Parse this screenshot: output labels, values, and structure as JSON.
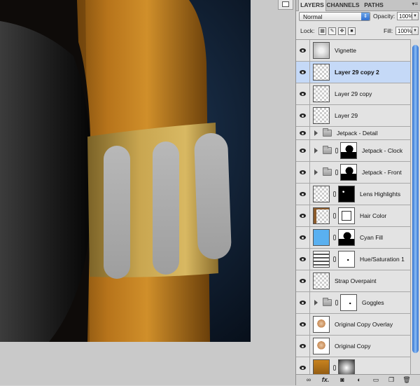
{
  "panel": {
    "tabs": [
      {
        "label": "LAYERS",
        "active": true
      },
      {
        "label": "CHANNELS",
        "active": false
      },
      {
        "label": "PATHS",
        "active": false
      }
    ],
    "menu_glyph": "▾≡",
    "blend_mode": "Normal",
    "opacity_label": "Opacity:",
    "opacity_value": "100%",
    "lock_label": "Lock:",
    "fill_label": "Fill:",
    "fill_value": "100%"
  },
  "layers": [
    {
      "name": "Vignette",
      "kind": "layer",
      "thumb": "vignette",
      "mask": false,
      "selected": false
    },
    {
      "name": "Layer 29 copy 2",
      "kind": "layer",
      "thumb": "transparent",
      "mask": false,
      "selected": true
    },
    {
      "name": "Layer 29 copy",
      "kind": "layer",
      "thumb": "transparent",
      "mask": false,
      "selected": false
    },
    {
      "name": "Layer 29",
      "kind": "layer",
      "thumb": "transparent",
      "mask": false,
      "selected": false
    },
    {
      "name": "Jetpack - Detail",
      "kind": "group",
      "mask": false,
      "selected": false
    },
    {
      "name": "Jetpack - Clock",
      "kind": "group-mask",
      "mask": true,
      "mask_type": "silhouette",
      "selected": false
    },
    {
      "name": "Jetpack - Front",
      "kind": "group-mask",
      "mask": true,
      "mask_type": "silhouette",
      "selected": false
    },
    {
      "name": "Lens Highlights",
      "kind": "layer",
      "thumb": "transparent",
      "mask": true,
      "mask_type": "black-dots",
      "selected": false
    },
    {
      "name": "Hair Color",
      "kind": "layer",
      "thumb": "hair",
      "mask": true,
      "mask_type": "hair-outline",
      "selected": false
    },
    {
      "name": "Cyan Fill",
      "kind": "layer",
      "thumb": "cyan",
      "mask": true,
      "mask_type": "silhouette",
      "selected": false
    },
    {
      "name": "Hue/Saturation 1",
      "kind": "adjustment",
      "thumb": "huesat",
      "mask": true,
      "mask_type": "white-small",
      "selected": false
    },
    {
      "name": "Strap Overpaint",
      "kind": "layer",
      "thumb": "transparent",
      "mask": false,
      "selected": false
    },
    {
      "name": "Goggles",
      "kind": "group-mask",
      "mask": true,
      "mask_type": "white-small",
      "selected": false
    },
    {
      "name": "Original Copy Overlay",
      "kind": "layer",
      "thumb": "portrait",
      "mask": false,
      "selected": false
    },
    {
      "name": "Original Copy",
      "kind": "layer",
      "thumb": "portrait",
      "mask": false,
      "selected": false
    },
    {
      "name": "",
      "kind": "layer",
      "thumb": "texture",
      "mask": true,
      "mask_type": "gradient",
      "selected": false
    }
  ],
  "bottom_bar": {
    "icons": [
      "link-icon",
      "fx-icon",
      "mask-icon",
      "adjustment-icon",
      "folder-icon",
      "new-layer-icon",
      "trash-icon"
    ],
    "fx_label": "fx."
  },
  "colors": {
    "selection": "#c5d9f7",
    "accent_blue": "#2e6fd0",
    "cyan_fill": "#5ab0f0"
  }
}
